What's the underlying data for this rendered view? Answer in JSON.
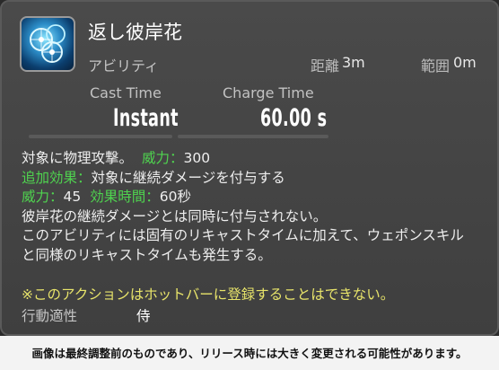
{
  "action": {
    "icon": "chakram-icon",
    "name": "返し彼岸花",
    "type": "アビリティ",
    "range_label": "距離",
    "range_value": "3m",
    "radius_label": "範囲",
    "radius_value": "0m"
  },
  "timing": {
    "cast_label": "Cast Time",
    "cast_value": "Instant",
    "charge_label": "Charge Time",
    "charge_value": "60.00 s"
  },
  "description": {
    "line1_text": "対象に物理攻撃。",
    "line1_key": "威力：",
    "line1_val": "300",
    "line2_key": "追加効果：",
    "line2_text": "対象に継続ダメージを付与する",
    "line3_key1": "威力：",
    "line3_val1": "45",
    "line3_key2": "効果時間：",
    "line3_val2": "60秒",
    "line4": "彼岸花の継続ダメージとは同時に付与されない。",
    "line5": "このアビリティには固有のリキャストタイムに加えて、ウェポンスキル",
    "line6": "と同様のリキャストタイムも発生する。"
  },
  "note": "※このアクションはホットバーに登録することはできない。",
  "job": {
    "label": "行動適性",
    "value": "侍"
  },
  "footer": "画像は最終調整前のものであり、リリース時には大きく変更される可能性があります。",
  "colors": {
    "panel_bg": "#444444",
    "highlight_green": "#4fd44f",
    "note_yellow": "#e8e46a",
    "footer_bg": "#f3f3f3"
  }
}
